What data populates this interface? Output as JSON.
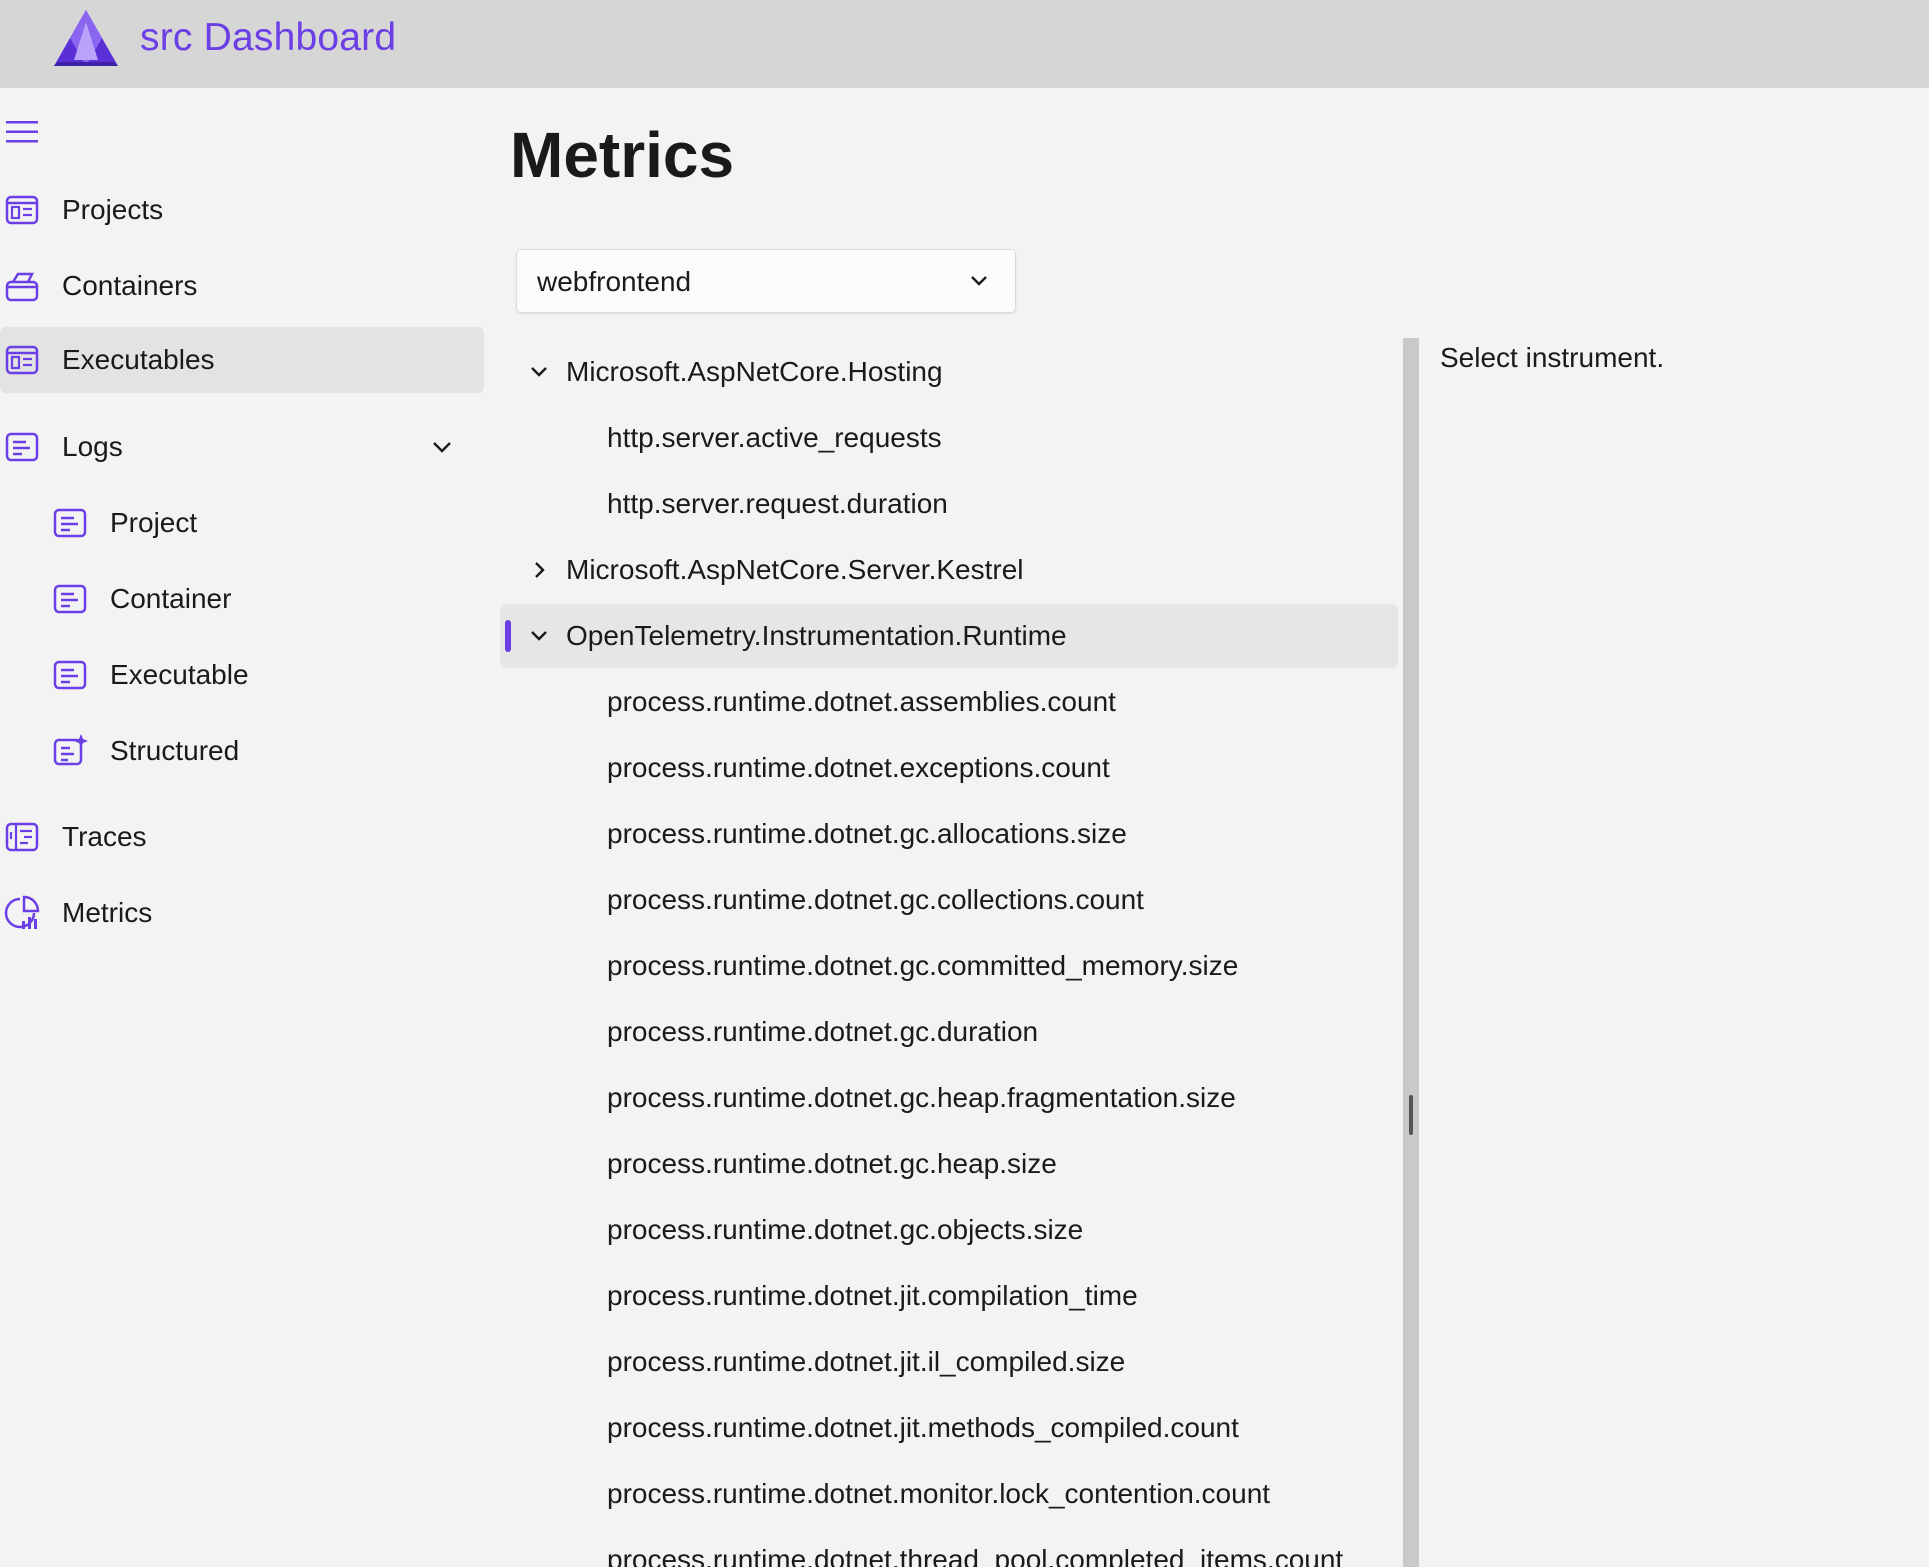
{
  "header": {
    "title": "src Dashboard",
    "logo_icon": "aspire-logo-icon",
    "accent": "#6b3ee6"
  },
  "sidebar": {
    "menu_icon": "hamburger-menu-icon",
    "items": [
      {
        "label": "Projects",
        "icon": "projects-icon"
      },
      {
        "label": "Containers",
        "icon": "containers-icon"
      },
      {
        "label": "Executables",
        "icon": "executables-icon",
        "active": true
      },
      {
        "label": "Logs",
        "icon": "logs-icon",
        "expanded": true
      },
      {
        "label": "Project",
        "icon": "log-project-icon"
      },
      {
        "label": "Container",
        "icon": "log-container-icon"
      },
      {
        "label": "Executable",
        "icon": "log-executable-icon"
      },
      {
        "label": "Structured",
        "icon": "log-structured-icon"
      },
      {
        "label": "Traces",
        "icon": "traces-icon"
      },
      {
        "label": "Metrics",
        "icon": "metrics-icon"
      }
    ]
  },
  "main": {
    "title": "Metrics",
    "resource_select": {
      "value": "webfrontend"
    },
    "detail_placeholder": "Select instrument.",
    "tree": [
      {
        "label": "Microsoft.AspNetCore.Hosting",
        "type": "group",
        "expanded": true
      },
      {
        "label": "http.server.active_requests",
        "type": "leaf"
      },
      {
        "label": "http.server.request.duration",
        "type": "leaf"
      },
      {
        "label": "Microsoft.AspNetCore.Server.Kestrel",
        "type": "group",
        "expanded": false
      },
      {
        "label": "OpenTelemetry.Instrumentation.Runtime",
        "type": "group",
        "expanded": true,
        "selected": true
      },
      {
        "label": "process.runtime.dotnet.assemblies.count",
        "type": "leaf"
      },
      {
        "label": "process.runtime.dotnet.exceptions.count",
        "type": "leaf"
      },
      {
        "label": "process.runtime.dotnet.gc.allocations.size",
        "type": "leaf"
      },
      {
        "label": "process.runtime.dotnet.gc.collections.count",
        "type": "leaf"
      },
      {
        "label": "process.runtime.dotnet.gc.committed_memory.size",
        "type": "leaf"
      },
      {
        "label": "process.runtime.dotnet.gc.duration",
        "type": "leaf"
      },
      {
        "label": "process.runtime.dotnet.gc.heap.fragmentation.size",
        "type": "leaf"
      },
      {
        "label": "process.runtime.dotnet.gc.heap.size",
        "type": "leaf"
      },
      {
        "label": "process.runtime.dotnet.gc.objects.size",
        "type": "leaf"
      },
      {
        "label": "process.runtime.dotnet.jit.compilation_time",
        "type": "leaf"
      },
      {
        "label": "process.runtime.dotnet.jit.il_compiled.size",
        "type": "leaf"
      },
      {
        "label": "process.runtime.dotnet.jit.methods_compiled.count",
        "type": "leaf"
      },
      {
        "label": "process.runtime.dotnet.monitor.lock_contention.count",
        "type": "leaf"
      },
      {
        "label": "process.runtime.dotnet.thread_pool.completed_items.count",
        "type": "leaf"
      }
    ]
  }
}
